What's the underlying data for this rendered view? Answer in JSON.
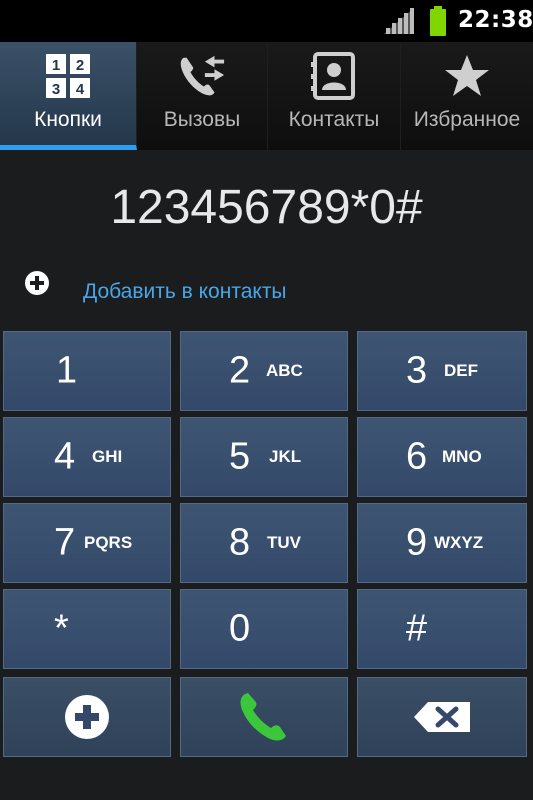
{
  "status": {
    "time": "22:38"
  },
  "tabs": [
    {
      "label": "Кнопки",
      "icon": "keypad-icon",
      "active": true
    },
    {
      "label": "Вызовы",
      "icon": "call-log-icon",
      "active": false
    },
    {
      "label": "Контакты",
      "icon": "contacts-icon",
      "active": false
    },
    {
      "label": "Избранное",
      "icon": "star-icon",
      "active": false
    }
  ],
  "display": {
    "number": "123456789*0#",
    "add_to_contacts": "Добавить в контакты"
  },
  "keys": [
    {
      "digit": "1",
      "letters": ""
    },
    {
      "digit": "2",
      "letters": "ABC"
    },
    {
      "digit": "3",
      "letters": "DEF"
    },
    {
      "digit": "4",
      "letters": "GHI"
    },
    {
      "digit": "5",
      "letters": "JKL"
    },
    {
      "digit": "6",
      "letters": "MNO"
    },
    {
      "digit": "7",
      "letters": "PQRS"
    },
    {
      "digit": "8",
      "letters": "TUV"
    },
    {
      "digit": "9",
      "letters": "WXYZ"
    },
    {
      "digit": "*",
      "letters": ""
    },
    {
      "digit": "0",
      "letters": ""
    },
    {
      "digit": "#",
      "letters": ""
    }
  ],
  "function_keys": [
    {
      "icon": "add-contact-icon"
    },
    {
      "icon": "phone-call-icon"
    },
    {
      "icon": "backspace-icon"
    }
  ],
  "colors": {
    "accent": "#2f9df0",
    "link": "#4aa5e8",
    "key": "#3e5572",
    "call_green": "#3cc63c",
    "battery_green": "#7fd600"
  }
}
